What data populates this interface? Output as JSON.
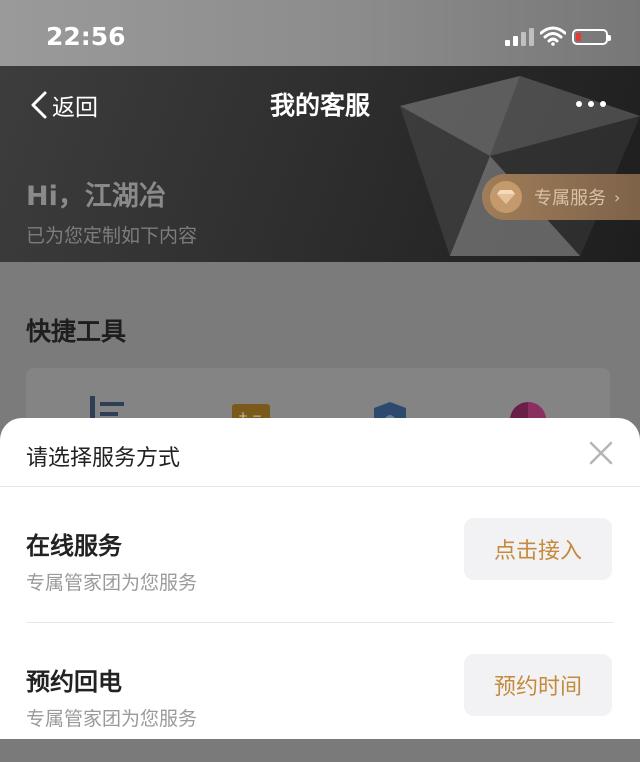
{
  "status_bar": {
    "time": "22:56"
  },
  "header": {
    "back_label": "返回",
    "title": "我的客服",
    "greeting": "Hi，江湖冶",
    "subtitle": "已为您定制如下内容",
    "vip_label": "专属服务",
    "vip_chevron": "›"
  },
  "page": {
    "section_title": "快捷工具"
  },
  "sheet": {
    "title": "请选择服务方式",
    "options": [
      {
        "title": "在线服务",
        "desc": "专属管家团为您服务",
        "button": "点击接入"
      },
      {
        "title": "预约回电",
        "desc": "专属管家团为您服务",
        "button": "预约时间"
      }
    ]
  },
  "colors": {
    "accent": "#c58b3c",
    "vip_bg": "#a07d58",
    "battery_low": "#e53935"
  }
}
